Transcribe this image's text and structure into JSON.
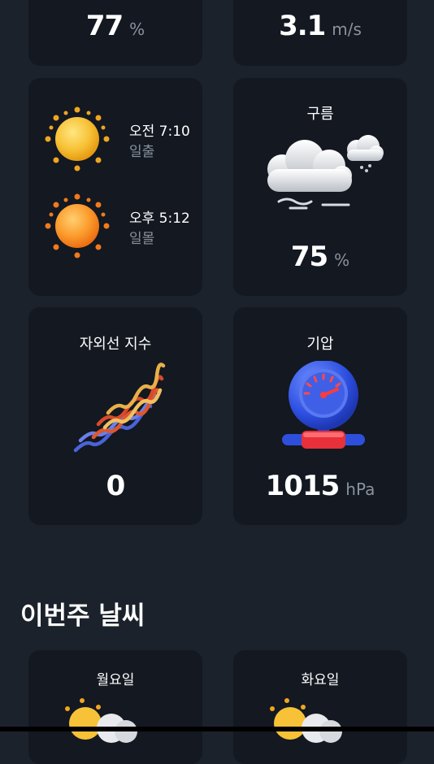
{
  "humidity": {
    "value": "77",
    "unit": "%"
  },
  "wind": {
    "value": "3.1",
    "unit": "m/s"
  },
  "sunrise": {
    "time": "오전 7:10",
    "label": "일출"
  },
  "sunset": {
    "time": "오후 5:12",
    "label": "일몰"
  },
  "clouds": {
    "title": "구름",
    "value": "75",
    "unit": "%"
  },
  "uv": {
    "title": "자외선 지수",
    "value": "0"
  },
  "pressure": {
    "title": "기압",
    "value": "1015",
    "unit": "hPa"
  },
  "weekly": {
    "title": "이번주 날씨",
    "days": [
      {
        "label": "월요일",
        "icon": "partly-cloudy-icon"
      },
      {
        "label": "화요일",
        "icon": "partly-cloudy-icon"
      }
    ]
  },
  "colors": {
    "background": "#1c222b",
    "card": "#131821",
    "muted_text": "#8a929c",
    "sun": "#f5b82a"
  }
}
